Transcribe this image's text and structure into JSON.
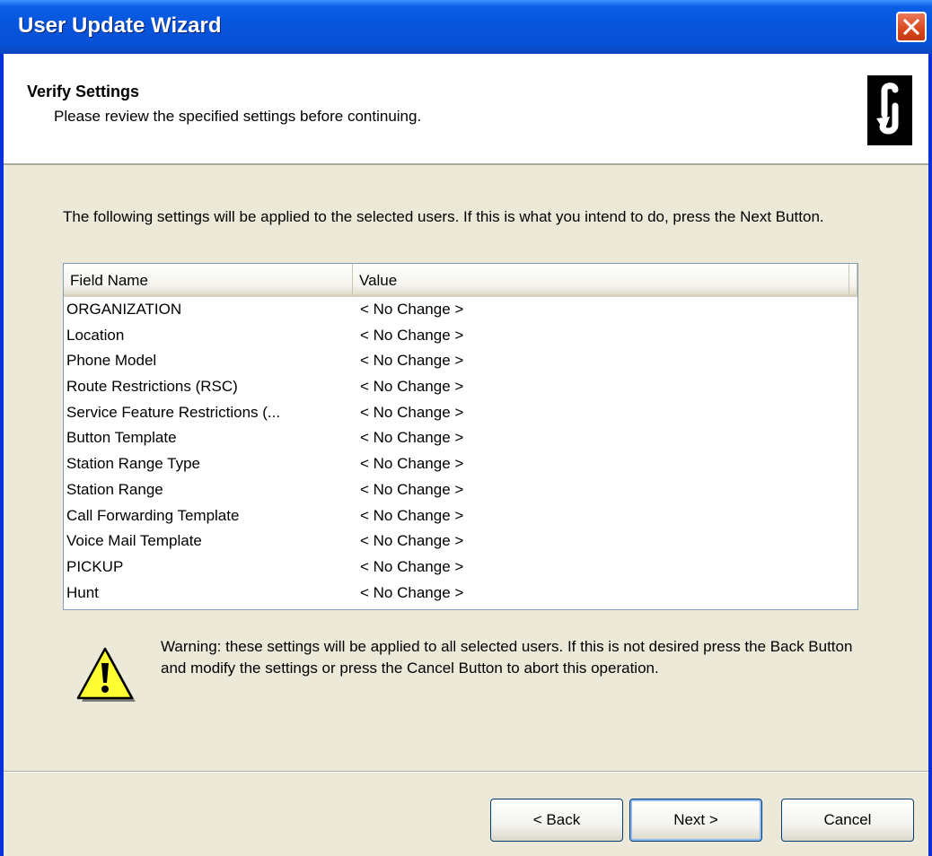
{
  "window": {
    "title": "User Update Wizard"
  },
  "header": {
    "title": "Verify Settings",
    "subtitle": "Please review the specified settings before continuing."
  },
  "intro": "The following settings will be applied to the selected users. If this is what you intend to do, press the Next Button.",
  "table": {
    "columns": [
      "Field Name",
      "Value"
    ],
    "rows": [
      {
        "field": "ORGANIZATION",
        "value": "< No Change >"
      },
      {
        "field": "Location",
        "value": "< No Change >"
      },
      {
        "field": "Phone Model",
        "value": "< No Change >"
      },
      {
        "field": "Route Restrictions (RSC)",
        "value": "< No Change >"
      },
      {
        "field": "Service Feature Restrictions (...",
        "value": "< No Change >"
      },
      {
        "field": "Button Template",
        "value": "< No Change >"
      },
      {
        "field": "Station Range Type",
        "value": "< No Change >"
      },
      {
        "field": "Station Range",
        "value": "< No Change >"
      },
      {
        "field": "Call Forwarding Template",
        "value": "< No Change >"
      },
      {
        "field": "Voice Mail Template",
        "value": "< No Change >"
      },
      {
        "field": "PICKUP",
        "value": "< No Change >"
      },
      {
        "field": "Hunt",
        "value": "< No Change >"
      }
    ]
  },
  "warning": "Warning: these settings will be applied to all selected users. If this is not desired press the Back Button and modify the settings or press the Cancel Button to abort this operation.",
  "buttons": {
    "back": "< Back",
    "next": "Next >",
    "cancel": "Cancel"
  },
  "icons": {
    "close": "close-icon",
    "logo": "app-logo-icon",
    "warning": "warning-icon"
  },
  "colors": {
    "titlebar": "#0855dd",
    "dialog": "#ece9d8",
    "close": "#d8471d"
  }
}
